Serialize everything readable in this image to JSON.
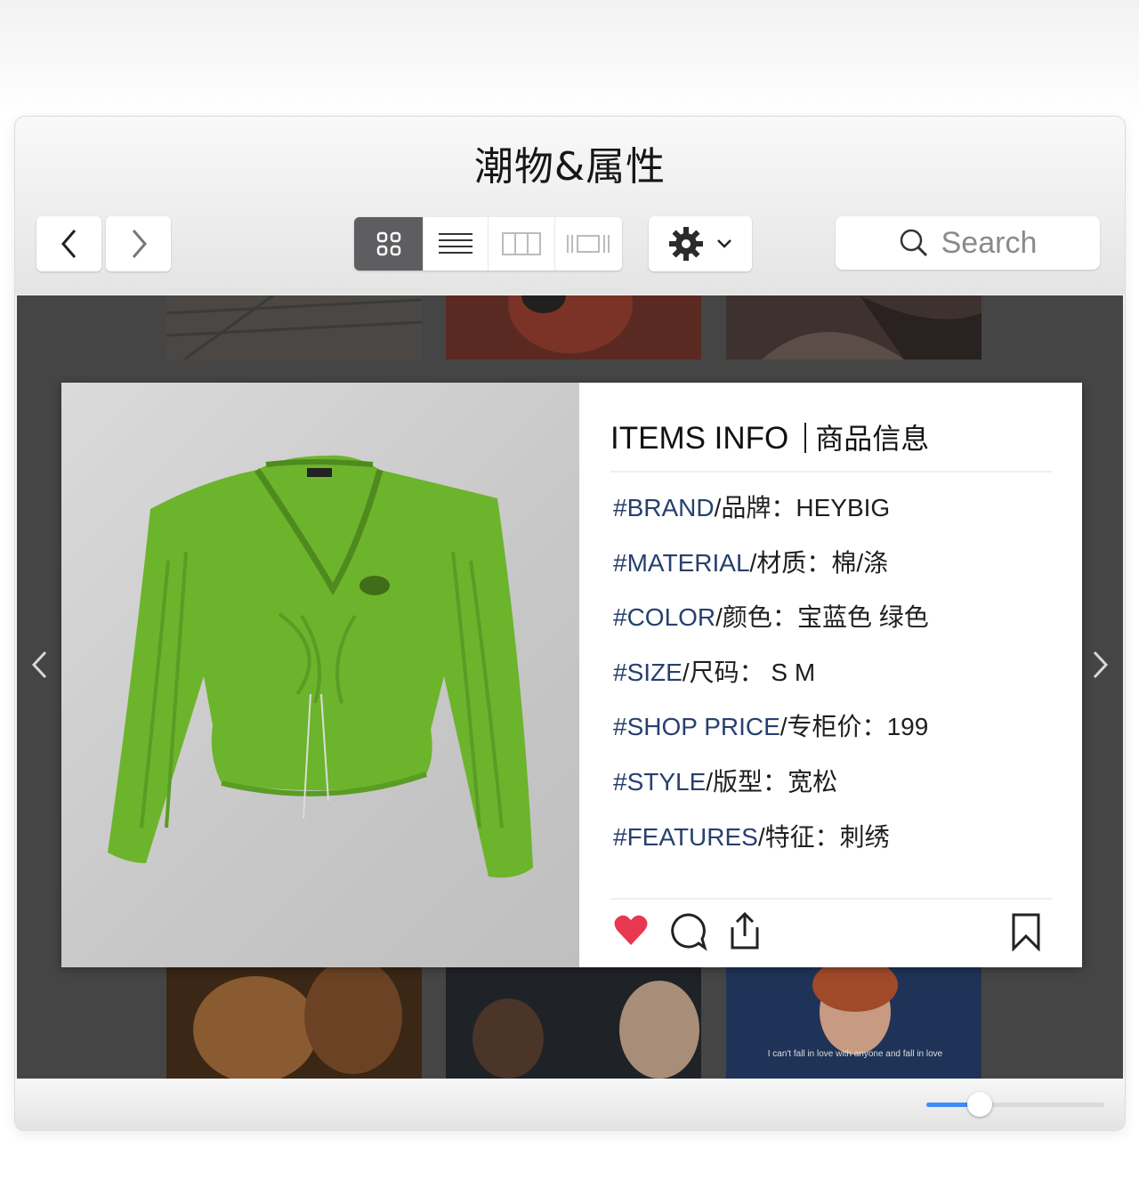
{
  "window": {
    "title": "潮物&属性"
  },
  "toolbar": {
    "back_icon": "chevron-left-icon",
    "forward_icon": "chevron-right-icon",
    "view_modes": [
      "grid-view-icon",
      "list-view-icon",
      "column-view-icon",
      "cover-flow-icon"
    ],
    "active_view": "grid-view-icon",
    "settings_icon": "gear-icon",
    "search": {
      "placeholder": "Search",
      "icon": "search-icon"
    }
  },
  "card": {
    "header": "ITEMS INFO",
    "header_cn": "商品信息",
    "rows": [
      {
        "tag": "#BRAND",
        "label": "/品牌：",
        "value": "HEYBIG"
      },
      {
        "tag": "#MATERIAL",
        "label": "/材质：",
        "value": "棉/涤"
      },
      {
        "tag": "#COLOR",
        "label": "/颜色：",
        "value": "宝蓝色 绿色"
      },
      {
        "tag": "#SIZE",
        "label": "/尺码：",
        "value": " S M"
      },
      {
        "tag": "#SHOP PRICE",
        "label": "/专柜价：",
        "value": "199"
      },
      {
        "tag": "#STYLE",
        "label": "/版型：",
        "value": "宽松"
      },
      {
        "tag": "#FEATURES",
        "label": "/特征：",
        "value": "刺绣"
      }
    ],
    "actions": [
      "heart-icon",
      "comment-icon",
      "share-icon",
      "bookmark-icon"
    ],
    "liked": true
  },
  "thumbnail_caption": "I can't fall in love with anyone and fall in love",
  "zoom": {
    "value": 0.3
  },
  "colors": {
    "accent": "#3f8cf4",
    "tag": "#27406e",
    "heart": "#e8384f",
    "sweater": "#6cb42c",
    "content_bg": "#454545"
  }
}
